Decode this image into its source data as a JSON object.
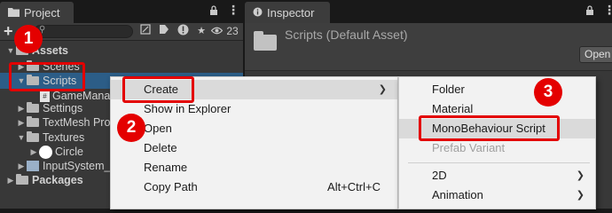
{
  "project": {
    "tab_label": "Project",
    "search_placeholder": "",
    "hidden_count": "23",
    "tree": [
      {
        "label": "Assets"
      },
      {
        "label": "Scenes"
      },
      {
        "label": "Scripts"
      },
      {
        "label": "GameManager"
      },
      {
        "label": "Settings"
      },
      {
        "label": "TextMesh Pro"
      },
      {
        "label": "Textures"
      },
      {
        "label": "Circle"
      },
      {
        "label": "InputSystem_Actions"
      },
      {
        "label": "Packages"
      }
    ]
  },
  "inspector": {
    "tab_label": "Inspector",
    "title": "Scripts (Default Asset)",
    "open_label": "Open"
  },
  "context_menu": {
    "items": [
      {
        "label": "Create",
        "has_submenu": true
      },
      {
        "label": "Show in Explorer"
      },
      {
        "label": "Open"
      },
      {
        "label": "Delete"
      },
      {
        "label": "Rename"
      },
      {
        "label": "Copy Path",
        "shortcut": "Alt+Ctrl+C"
      }
    ]
  },
  "create_submenu": {
    "items": [
      {
        "label": "Folder"
      },
      {
        "label": "Material"
      },
      {
        "label": "MonoBehaviour Script"
      },
      {
        "label": "Prefab Variant",
        "disabled": true
      },
      {
        "label": "2D",
        "has_submenu": true
      },
      {
        "label": "Animation",
        "has_submenu": true
      }
    ]
  },
  "annotations": {
    "badges": [
      "1",
      "2",
      "3"
    ],
    "highlight_color": "#e30000"
  },
  "colors": {
    "selection": "#2c5d87",
    "panel_bg": "#383838",
    "menu_bg": "#f2f2f2"
  }
}
